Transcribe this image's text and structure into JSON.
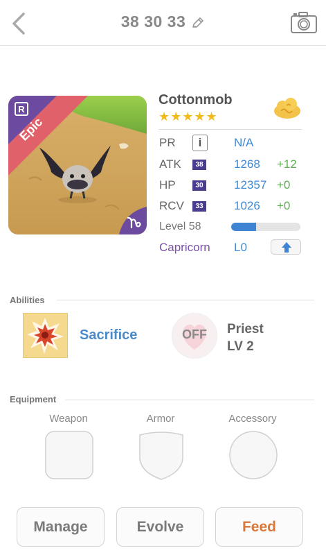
{
  "header": {
    "title": "38 30 33"
  },
  "monster": {
    "name": "Cottonmob",
    "rarity": "Epic",
    "star_count": 5,
    "stars": "★★★★★",
    "stats": {
      "pr": {
        "label": "PR",
        "value": "N/A"
      },
      "atk": {
        "label": "ATK",
        "badge": "38",
        "value": "1268",
        "plus": "+12"
      },
      "hp": {
        "label": "HP",
        "badge": "30",
        "value": "12357",
        "plus": "+0"
      },
      "rcv": {
        "label": "RCV",
        "badge": "33",
        "value": "1026",
        "plus": "+0"
      }
    },
    "level": {
      "label": "Level 58",
      "progress_fraction": 0.36
    },
    "sign": {
      "label": "Capricorn",
      "level": "L0"
    }
  },
  "abilities": {
    "title": "Abilities",
    "primary": {
      "name": "Sacrifice"
    },
    "secondary": {
      "state": "OFF",
      "name": "Priest",
      "level": "LV 2"
    }
  },
  "equipment": {
    "title": "Equipment",
    "weapon": "Weapon",
    "armor": "Armor",
    "accessory": "Accessory"
  },
  "actions": {
    "manage": "Manage",
    "evolve": "Evolve",
    "feed": "Feed"
  },
  "colors": {
    "accent_blue": "#3f8ad2",
    "stat_green": "#5bb04f",
    "sign_purple": "#7a52a8",
    "badge_purple": "#4a3d8f",
    "star_gold": "#f2bb1d",
    "feed_orange": "#d9783a",
    "epic_ribbon": "#e0616a"
  },
  "icons": {
    "back": "chevron-left-icon",
    "edit": "pencil-icon",
    "camera": "camera-icon",
    "element": "cloud-icon",
    "info": "info-icon",
    "upgrade": "arrow-up-icon",
    "sign": "capricorn-icon",
    "rarity": "rarity-r-icon"
  }
}
